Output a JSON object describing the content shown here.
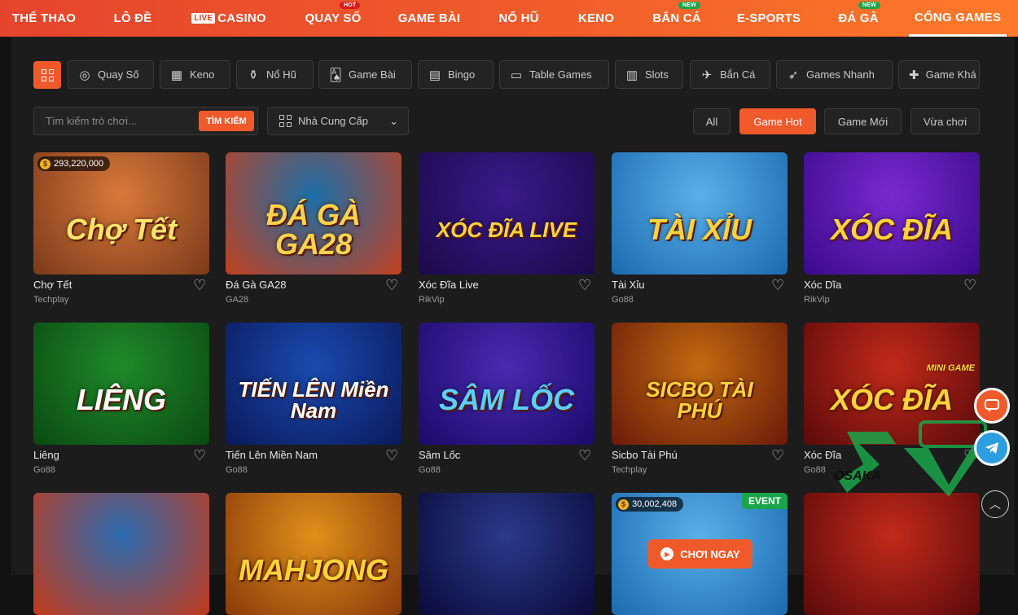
{
  "nav": {
    "items": [
      {
        "label": "THỂ THAO"
      },
      {
        "label": "LÔ ĐỀ"
      },
      {
        "label": "CASINO",
        "tag": "LIVE"
      },
      {
        "label": "QUAY SỐ",
        "badge": "HOT"
      },
      {
        "label": "GAME BÀI"
      },
      {
        "label": "NỔ HŨ"
      },
      {
        "label": "KENO"
      },
      {
        "label": "BẮN CÁ",
        "badge": "NEW"
      },
      {
        "label": "E-SPORTS"
      },
      {
        "label": "ĐÁ GÀ",
        "badge": "NEW"
      },
      {
        "label": "CỔNG GAMES"
      }
    ],
    "active": "CỔNG GAMES"
  },
  "categories": [
    {
      "label": "Quay Số",
      "icon": "lottery-ball-icon"
    },
    {
      "label": "Keno",
      "icon": "keno-grid-icon"
    },
    {
      "label": "Nổ Hũ",
      "icon": "jar-icon"
    },
    {
      "label": "Game Bài",
      "icon": "cards-icon"
    },
    {
      "label": "Bingo",
      "icon": "bingo-icon"
    },
    {
      "label": "Table Games",
      "icon": "table-icon"
    },
    {
      "label": "Slots",
      "icon": "slots-icon"
    },
    {
      "label": "Bắn Cá",
      "icon": "fish-icon"
    },
    {
      "label": "Games Nhanh",
      "icon": "rocket-icon"
    },
    {
      "label": "Game Khá",
      "icon": "puzzle-icon"
    }
  ],
  "search": {
    "placeholder": "Tìm kiếm trò chơi...",
    "button": "TÌM KIẾM"
  },
  "provider_select": {
    "label": "Nhà Cung Cấp"
  },
  "filters": [
    {
      "label": "All"
    },
    {
      "label": "Game Hot"
    },
    {
      "label": "Game Mới"
    },
    {
      "label": "Vừa chơi"
    }
  ],
  "active_filter": "Game Hot",
  "games": [
    {
      "name": "Chợ Tết",
      "provider": "Techplay",
      "art": "Chợ Tết",
      "jackpot": "293,220,000",
      "colors": [
        "#d9793a",
        "#7a3a1a"
      ],
      "art_color": "#ffe36b"
    },
    {
      "name": "Đá Gà GA28",
      "provider": "GA28",
      "art": "ĐÁ GÀ GA28",
      "colors": [
        "#1b6fa8",
        "#c2401f"
      ],
      "art_color": "#ffd24a"
    },
    {
      "name": "Xóc Đĩa Live",
      "provider": "RikVip",
      "art": "XÓC ĐĨA LIVE",
      "colors": [
        "#3a1a8a",
        "#1a0a4a"
      ],
      "art_color": "#ffd23a"
    },
    {
      "name": "Tài Xỉu",
      "provider": "Go88",
      "art": "TÀI XỈU",
      "colors": [
        "#5ab0e8",
        "#1a6ab0"
      ],
      "art_color": "#ffd23a"
    },
    {
      "name": "Xóc Dĩa",
      "provider": "RikVip",
      "art": "XÓC ĐĨA",
      "colors": [
        "#7a2ad0",
        "#3a0a8a"
      ],
      "art_color": "#ffd23a"
    },
    {
      "name": "Liêng",
      "provider": "Go88",
      "art": "LIÊNG",
      "colors": [
        "#1f8a2a",
        "#0a4a12"
      ],
      "art_color": "#ffffff"
    },
    {
      "name": "Tiến Lên Miền Nam",
      "provider": "Go88",
      "art": "TIẾN LÊN Miền Nam",
      "colors": [
        "#1a4ab0",
        "#0a1a5a"
      ],
      "art_color": "#ffffff"
    },
    {
      "name": "Sâm Lốc",
      "provider": "Go88",
      "art": "SÂM LỐC",
      "colors": [
        "#4a2ab0",
        "#1a0a6a"
      ],
      "art_color": "#5ad0ff"
    },
    {
      "name": "Sicbo Tài Phú",
      "provider": "Techplay",
      "art": "SICBO TÀI PHÚ",
      "colors": [
        "#c26a10",
        "#6a1a0a"
      ],
      "art_color": "#ffd23a"
    },
    {
      "name": "Xóc Đĩa",
      "provider": "Go88",
      "art": "XÓC ĐĨA",
      "colors": [
        "#c22a1a",
        "#5a0a0a"
      ],
      "art_color": "#ffd23a",
      "mini": "MINI GAME"
    },
    {
      "name": "",
      "provider": "",
      "art": "",
      "colors": [
        "#2a6ab0",
        "#c23a1a"
      ],
      "art_color": "#ffd23a"
    },
    {
      "name": "",
      "provider": "",
      "art": "MAHJONG",
      "colors": [
        "#e0901a",
        "#8a3a0a"
      ],
      "art_color": "#ffd23a"
    },
    {
      "name": "",
      "provider": "",
      "art": "",
      "colors": [
        "#2a3a8a",
        "#0a0a3a"
      ],
      "art_color": "#ffd23a"
    },
    {
      "name": "",
      "provider": "",
      "art": "",
      "colors": [
        "#5ab0e8",
        "#1a6ab0"
      ],
      "art_color": "#ffd23a",
      "jackpot": "30,002,408",
      "event": "EVENT",
      "play": "CHƠI NGAY"
    },
    {
      "name": "",
      "provider": "",
      "art": "",
      "colors": [
        "#c22a1a",
        "#5a0a0a"
      ],
      "art_color": "#ffd23a"
    }
  ],
  "watermark": {
    "text": "OSAKA",
    "colors": [
      "#1aa54a",
      "#222222"
    ]
  },
  "floating": {
    "chat_icon": "chat-bubble-icon",
    "telegram_icon": "telegram-icon",
    "top_icon": "chevron-up-icon"
  }
}
